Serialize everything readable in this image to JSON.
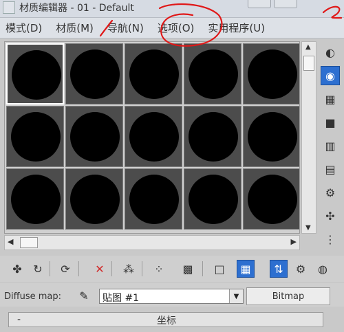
{
  "window": {
    "title": "材质编辑器 - 01 - Default"
  },
  "menubar": {
    "items": [
      {
        "label": "模式(D)"
      },
      {
        "label": "材质(M)"
      },
      {
        "label": "导航(N)"
      },
      {
        "label": "选项(O)"
      },
      {
        "label": "实用程序(U)"
      }
    ]
  },
  "sample_slots": {
    "count": 15,
    "active_index": 0
  },
  "side_toolbar": {
    "icons": [
      "sample-type-icon",
      "backlight-icon",
      "background-icon",
      "uv-tiling-icon",
      "video-color-check-icon",
      "make-preview-icon",
      "options-icon",
      "select-by-material-icon",
      "material-navigator-icon"
    ]
  },
  "bottom_toolbar": {
    "icons": [
      "get-material-icon",
      "put-to-scene-icon",
      "assign-to-selection-icon",
      "reset-map-icon",
      "make-unique-icon",
      "put-to-library-icon",
      "material-id-icon",
      "show-map-icon",
      "show-end-result-icon",
      "go-to-parent-icon",
      "go-forward-icon"
    ]
  },
  "map_row": {
    "label": "Diffuse map:",
    "select_value": "贴图 #1",
    "type_button": "Bitmap"
  },
  "rollout": {
    "toggle": "-",
    "title": "坐标"
  }
}
